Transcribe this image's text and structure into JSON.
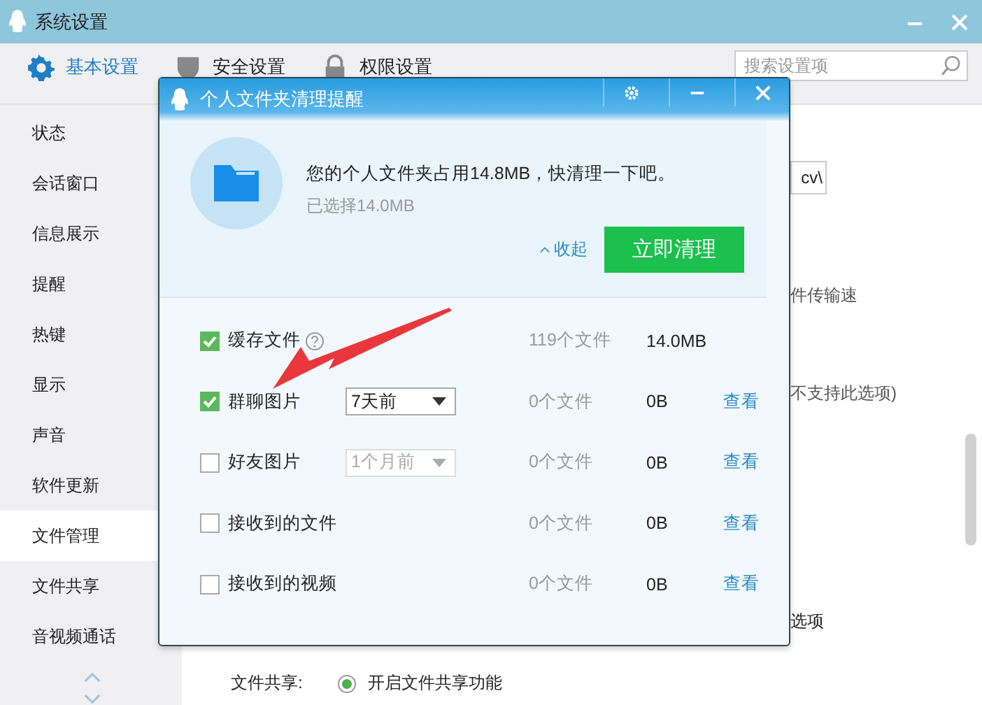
{
  "window": {
    "title": "系统设置"
  },
  "tabs": [
    {
      "label": "基本设置",
      "selected": true
    },
    {
      "label": "安全设置",
      "selected": false
    },
    {
      "label": "权限设置",
      "selected": false
    }
  ],
  "search": {
    "placeholder": "搜索设置项"
  },
  "sidebar": {
    "items": [
      {
        "label": "状态",
        "selected": false
      },
      {
        "label": "会话窗口",
        "selected": false
      },
      {
        "label": "信息展示",
        "selected": false
      },
      {
        "label": "提醒",
        "selected": false
      },
      {
        "label": "热键",
        "selected": false
      },
      {
        "label": "显示",
        "selected": false
      },
      {
        "label": "声音",
        "selected": false
      },
      {
        "label": "软件更新",
        "selected": false
      },
      {
        "label": "文件管理",
        "selected": true
      },
      {
        "label": "文件共享",
        "selected": false
      },
      {
        "label": "音视频通话",
        "selected": false
      }
    ]
  },
  "content": {
    "path_value": "cv\\",
    "fragments": [
      "件传输速",
      "不支持此选项)",
      "选项"
    ],
    "file_share": {
      "label": "文件共享:",
      "option": "开启文件共享功能",
      "selected": true
    }
  },
  "dialog": {
    "title": "个人文件夹清理提醒",
    "message": "您的个人文件夹占用14.8MB，快清理一下吧。",
    "selected_size": "已选择14.0MB",
    "collapse_link": "收起",
    "clean_button": "立即清理",
    "rows": [
      {
        "label": "缓存文件",
        "checked": true,
        "help": true,
        "count": "119个文件",
        "size": "14.0MB"
      },
      {
        "label": "群聊图片",
        "checked": true,
        "help": false,
        "period": {
          "value": "7天前",
          "disabled": false
        },
        "count": "0个文件",
        "size": "0B",
        "view": "查看"
      },
      {
        "label": "好友图片",
        "checked": false,
        "help": false,
        "period": {
          "value": "1个月前",
          "disabled": true
        },
        "count": "0个文件",
        "size": "0B",
        "view": "查看"
      },
      {
        "label": "接收到的文件",
        "checked": false,
        "help": false,
        "count": "0个文件",
        "size": "0B",
        "view": "查看"
      },
      {
        "label": "接收到的视频",
        "checked": false,
        "help": false,
        "count": "0个文件",
        "size": "0B",
        "view": "查看"
      }
    ]
  }
}
